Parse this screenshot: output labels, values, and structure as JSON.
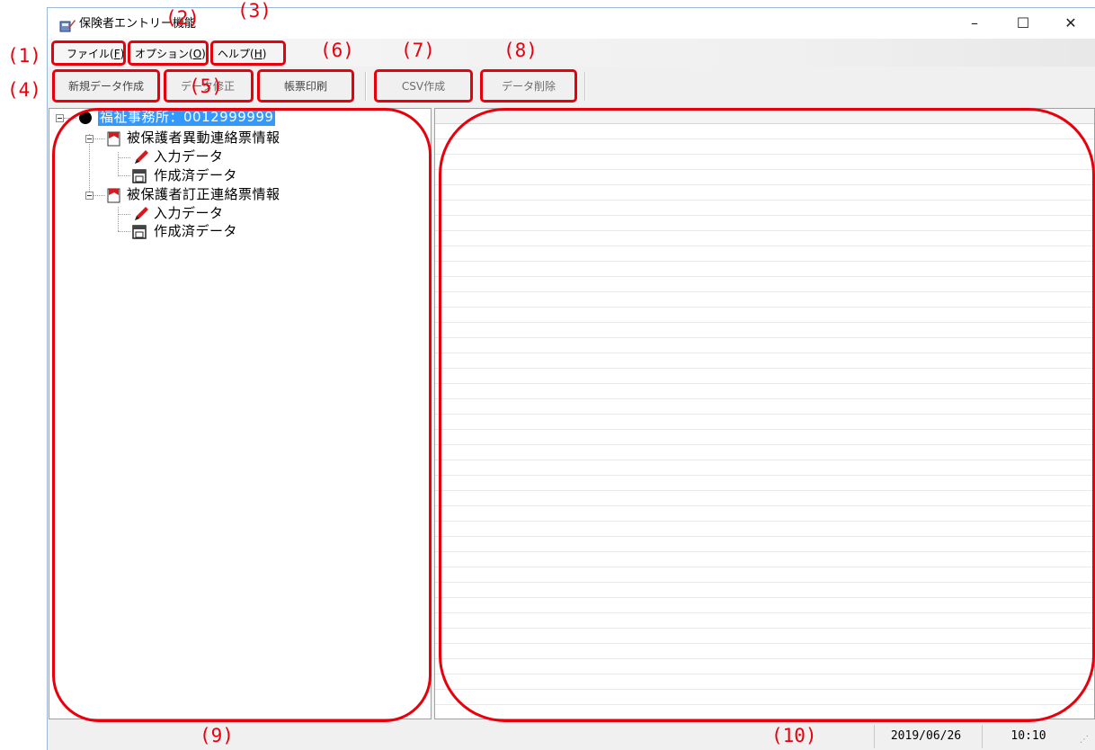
{
  "window": {
    "title": "保険者エントリー機能",
    "minimize_glyph": "–",
    "maximize_glyph": "☐",
    "close_glyph": "✕"
  },
  "menubar": {
    "items": [
      {
        "label": "ファイル(",
        "key": "F",
        "suffix": ")"
      },
      {
        "label": "オプション(",
        "key": "O",
        "suffix": ")"
      },
      {
        "label": "ヘルプ(",
        "key": "H",
        "suffix": ")"
      }
    ]
  },
  "toolbar": {
    "buttons": [
      "新規データ作成",
      "データ修正",
      "帳票印刷",
      "CSV作成",
      "データ削除"
    ]
  },
  "tree": {
    "root": "福祉事務所：0012999999",
    "groups": [
      {
        "label": "被保護者異動連絡票情報",
        "children": [
          "入力データ",
          "作成済データ"
        ]
      },
      {
        "label": "被保護者訂正連絡票情報",
        "children": [
          "入力データ",
          "作成済データ"
        ]
      }
    ]
  },
  "statusbar": {
    "date": "2019/06/26",
    "time": "10:10"
  },
  "annotations": [
    "(1)",
    "(2)",
    "(3)",
    "(4)",
    "(5)",
    "(6)",
    "(7)",
    "(8)",
    "(9)",
    "(10)"
  ],
  "colors": {
    "annotation_red": "#e8000c",
    "selection_blue": "#3399ff",
    "disabled_text": "#6d6d6d"
  },
  "icons": {
    "app": "app-pen-icon",
    "root": "office-bullet-icon",
    "group": "red-book-icon",
    "input": "pencil-icon",
    "created": "printer-icon"
  }
}
